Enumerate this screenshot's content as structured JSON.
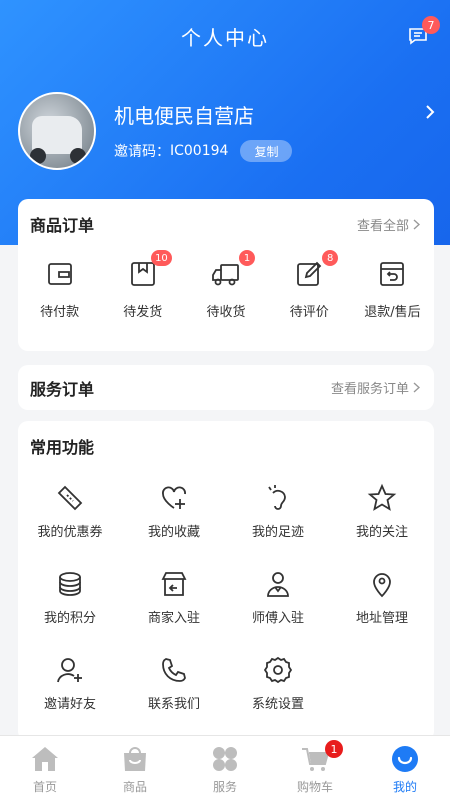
{
  "colors": {
    "accent": "#1e7bf5",
    "badge": "#ff5a5a",
    "header_gradient_start": "#2f93ff",
    "header_gradient_end": "#1766ec"
  },
  "header": {
    "title": "个人中心",
    "message_icon": "message-icon",
    "message_badge": "7"
  },
  "profile": {
    "store_name": "机电便民自营店",
    "invite_label": "邀请码：",
    "invite_code": "IC00194",
    "copy_label": "复制"
  },
  "orders": {
    "title": "商品订单",
    "view_all": "查看全部",
    "items": [
      {
        "label": "待付款",
        "icon": "wallet-icon",
        "badge": ""
      },
      {
        "label": "待发货",
        "icon": "package-icon",
        "badge": "10"
      },
      {
        "label": "待收货",
        "icon": "truck-icon",
        "badge": "1"
      },
      {
        "label": "待评价",
        "icon": "edit-icon",
        "badge": "8"
      },
      {
        "label": "退款/售后",
        "icon": "refund-icon",
        "badge": ""
      }
    ]
  },
  "service": {
    "title": "服务订单",
    "view_all": "查看服务订单"
  },
  "functions": {
    "title": "常用功能",
    "items": [
      {
        "label": "我的优惠券",
        "icon": "coupon-icon"
      },
      {
        "label": "我的收藏",
        "icon": "heart-plus-icon"
      },
      {
        "label": "我的足迹",
        "icon": "footprint-icon"
      },
      {
        "label": "我的关注",
        "icon": "star-icon"
      },
      {
        "label": "我的积分",
        "icon": "coins-icon"
      },
      {
        "label": "商家入驻",
        "icon": "store-icon"
      },
      {
        "label": "师傅入驻",
        "icon": "worker-icon"
      },
      {
        "label": "地址管理",
        "icon": "location-icon"
      },
      {
        "label": "邀请好友",
        "icon": "add-user-icon"
      },
      {
        "label": "联系我们",
        "icon": "phone-icon"
      },
      {
        "label": "系统设置",
        "icon": "gear-icon"
      }
    ]
  },
  "tabbar": {
    "items": [
      {
        "label": "首页",
        "icon": "home-icon"
      },
      {
        "label": "商品",
        "icon": "bag-icon"
      },
      {
        "label": "服务",
        "icon": "grid-icon"
      },
      {
        "label": "购物车",
        "icon": "cart-icon",
        "badge": "1"
      },
      {
        "label": "我的",
        "icon": "smile-icon",
        "active": true
      }
    ]
  }
}
